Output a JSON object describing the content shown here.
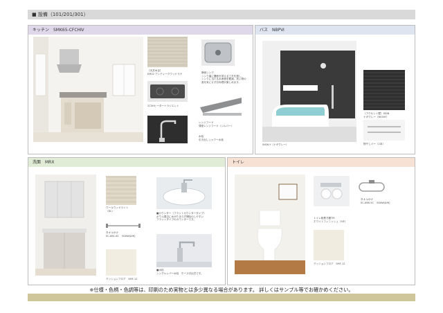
{
  "header": {
    "title": "■ 設備（101/201/301）"
  },
  "kitchen": {
    "title": "キッチン　SMK65-CFCHⅣ",
    "captions": {
      "wood": "［天井木目］\nEM02 アンティークウッドラテ",
      "sink": "静音シンク\nシンク裏に騒音を抑える工夫を施し、\nシンクに当たる水滴音を軽減。洗い物の\n音を気にせずお料理が楽しめます。",
      "ih": "2口IHヒーター＋ラジエント",
      "hood": "レンジフード\n薄型レンジフード（シルバー）",
      "faucet": "水栓\n引き出しシャワー水栓"
    }
  },
  "bath": {
    "title": "バス　NBPⅥ",
    "captions": {
      "main": "INGN-Y（ナギグレー）",
      "panel": "［アクセント壁］ISDN\nナギグレー（NIGNY）",
      "shelf": "物干しバー（2本）"
    }
  },
  "washroom": {
    "title": "洗面　MRX",
    "captions": {
      "wood": "ウールウッドライト\n（DL）",
      "counter": "■カウンター（フラットカウンタータイプ）\nボウル周辺に水がたまらず掃除のしやすい\nフラットタイプのカウンターです。",
      "towel": "タオルかけ\nSC-881-6C　（KAWAJUN）",
      "faucet": "■水栓\nシングルレバー水栓　ホース引出式です。",
      "floor": "クッションフロア　SMF-12"
    }
  },
  "toilet": {
    "title": "トイレ",
    "captions": {
      "holder": "トイレ紙巻き器TM\nホワイトフィニッシュ（SIF）",
      "towel": "タオルかけ\nSC-866-5C　（KAWAJUN）",
      "floor": "クッションフロア　SMF-12"
    }
  },
  "footer": {
    "note": "※仕様・色柄・色調等は、印刷のため実物とは多少異なる場合があります。 詳しくはサンプル等でお確かめください。"
  },
  "colors": {
    "header_bar": "#d9d9d9",
    "footer_bar": "#cfc69b",
    "kitchen_title": "#ded8ea",
    "bath_title": "#dfe4f1",
    "wash_title": "#e0ecd5",
    "toilet_title": "#f7e1d4"
  }
}
